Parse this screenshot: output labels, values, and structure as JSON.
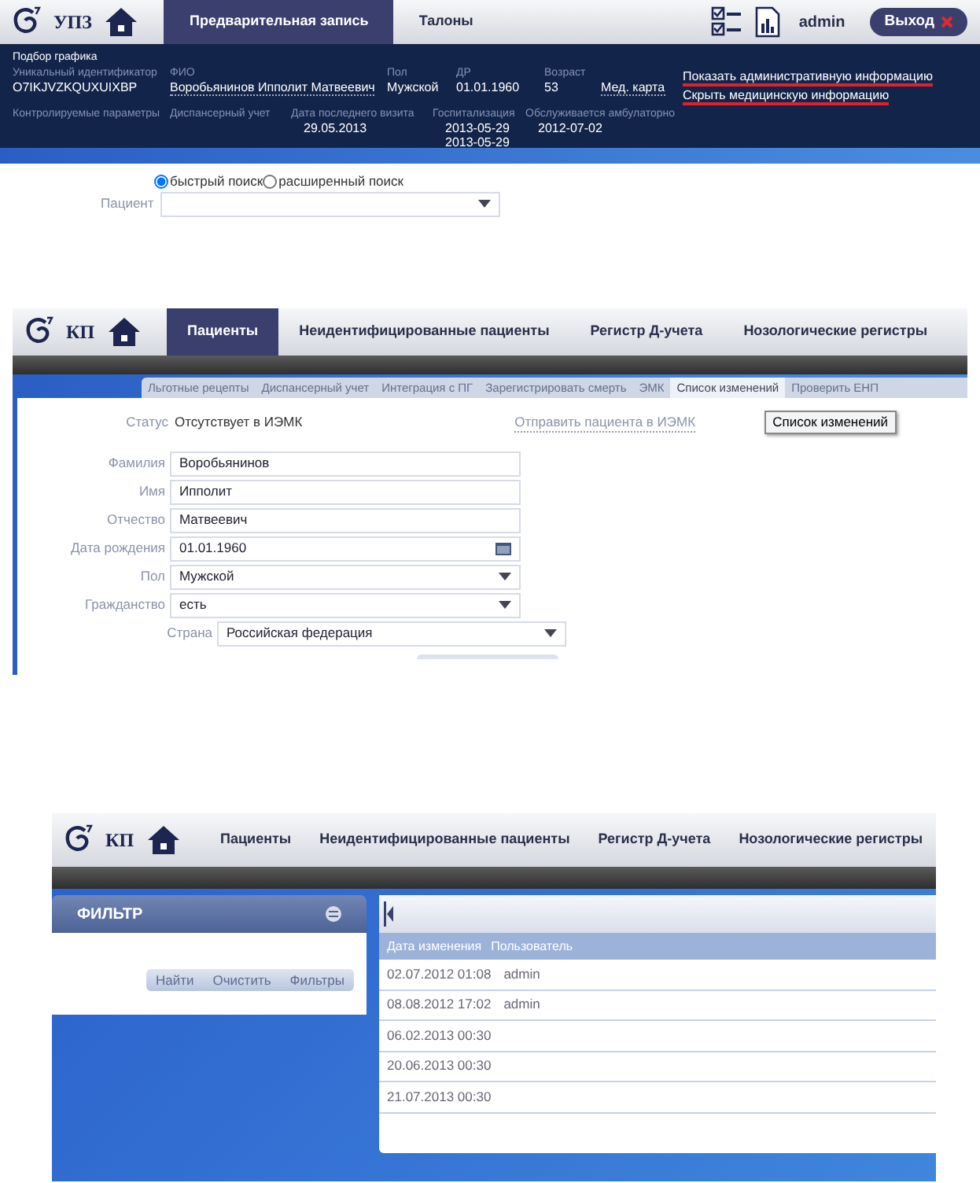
{
  "schedule_screen": {
    "logo": "УПЗ",
    "tabs": [
      {
        "label": "Предварительная запись",
        "selected": true
      },
      {
        "label": "Талоны",
        "selected": false
      }
    ],
    "user": "admin",
    "logout": "Выход",
    "section_title": "Подбор графика",
    "info_row_1": [
      {
        "label": "Уникальный идентификатор",
        "lines": [
          "O7IKJVZKQUXUIXBP"
        ],
        "kind": "text"
      },
      {
        "label": "ФИО",
        "lines": [
          "Воробьянинов Ипполит Матвеевич"
        ],
        "kind": "link"
      },
      {
        "label": "Пол",
        "lines": [
          "Мужской"
        ],
        "kind": "text"
      },
      {
        "label": "ДР",
        "lines": [
          "01.01.1960"
        ],
        "kind": "text"
      },
      {
        "label": "Возраст",
        "lines": [
          "53"
        ],
        "kind": "text"
      },
      {
        "lines": [
          "Мед. карта"
        ],
        "kind": "link"
      }
    ],
    "info_links": [
      "Показать административную информацию",
      "Скрыть медицинскую информацию"
    ],
    "info_row_2": [
      {
        "label": "Контролируемые параметры"
      },
      {
        "label": "Диспансерный учет"
      },
      {
        "label": "Дата последнего визита",
        "lines": [
          "29.05.2013"
        ]
      },
      {
        "label": "Госпитализация",
        "lines": [
          "2013-05-29",
          "2013-05-29"
        ]
      },
      {
        "label": "Обслуживается амбулаторно",
        "lines": [
          "2012-07-02"
        ]
      }
    ],
    "search_modes": [
      {
        "label": "быстрый поиск",
        "selected": true
      },
      {
        "label": "расширенный поиск",
        "selected": false
      }
    ],
    "patient_label": "Пациент"
  },
  "patient_screen": {
    "logo": "КП",
    "tabs": [
      {
        "label": "Пациенты",
        "selected": true
      },
      {
        "label": "Неидентифицированные пациенты",
        "selected": false
      },
      {
        "label": "Регистр Д-учета",
        "selected": false
      },
      {
        "label": "Нозологические регистры",
        "selected": false
      }
    ],
    "subtabs": [
      {
        "label": "Льготные рецепты",
        "selected": false
      },
      {
        "label": "Диспансерный учет",
        "selected": false
      },
      {
        "label": "Интеграция с ПГ",
        "selected": false
      },
      {
        "label": "Зарегистрировать смерть",
        "selected": false
      },
      {
        "label": "ЭМК",
        "selected": false
      },
      {
        "label": "Список изменений",
        "selected": true
      },
      {
        "label": "Проверить ЕНП",
        "selected": false
      }
    ],
    "status_label": "Статус",
    "status": "Отсутствует в ИЭМК",
    "send_link": "Отправить пациента в ИЭМК",
    "changes_button": "Список изменений",
    "fields": [
      {
        "label": "Фамилия",
        "value": "Воробьянинов",
        "kind": "text"
      },
      {
        "label": "Имя",
        "value": "Ипполит",
        "kind": "text"
      },
      {
        "label": "Отчество",
        "value": "Матвеевич",
        "kind": "text"
      },
      {
        "label": "Дата рождения",
        "value": "01.01.1960",
        "kind": "date"
      },
      {
        "label": "Пол",
        "value": "Мужской",
        "kind": "select"
      },
      {
        "label": "Гражданство",
        "value": "есть",
        "kind": "select"
      },
      {
        "label": "Страна",
        "value": "Российская федерация",
        "kind": "subselect"
      }
    ]
  },
  "changes_screen": {
    "logo": "КП",
    "tabs": [
      {
        "label": "Пациенты",
        "selected": false
      },
      {
        "label": "Неидентифицированные пациенты",
        "selected": false
      },
      {
        "label": "Регистр Д-учета",
        "selected": false
      },
      {
        "label": "Нозологические регистры",
        "selected": false
      }
    ],
    "filter_title": "ФИЛЬТР",
    "filter_buttons": [
      "Найти",
      "Очистить",
      "Фильтры"
    ],
    "columns": [
      "Дата изменения",
      "Пользователь"
    ],
    "rows": [
      {
        "cells": [
          "02.07.2012 01:08",
          "admin"
        ]
      },
      {
        "cells": [
          "08.08.2012 17:02",
          "admin"
        ]
      },
      {
        "cells": [
          "06.02.2013 00:30"
        ]
      },
      {
        "cells": [
          "20.06.2013 00:30"
        ]
      },
      {
        "cells": [
          "21.07.2013 00:30"
        ]
      }
    ]
  }
}
